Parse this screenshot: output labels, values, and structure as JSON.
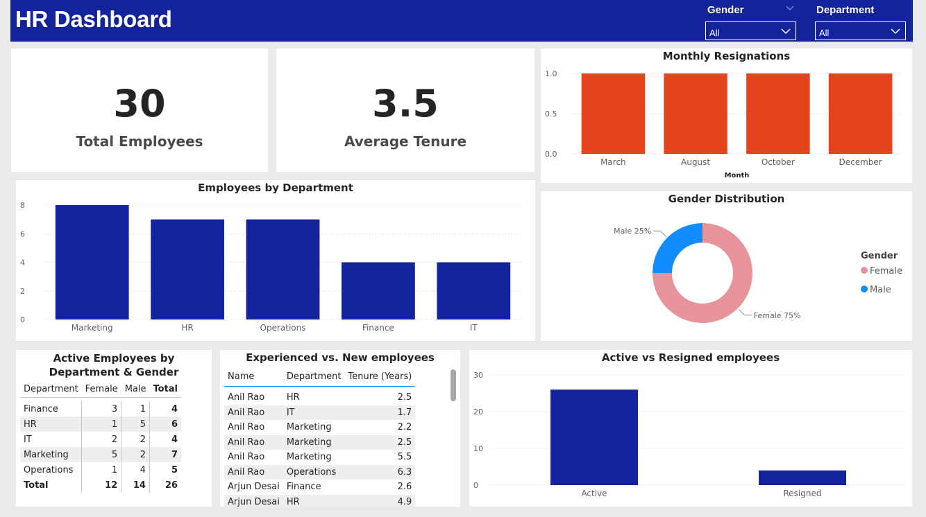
{
  "header": {
    "title": "HR Dashboard",
    "slicers": [
      {
        "label": "Gender",
        "value": "All"
      },
      {
        "label": "Department",
        "value": "All"
      }
    ]
  },
  "kpis": [
    {
      "value": "30",
      "label": "Total Employees"
    },
    {
      "value": "3.5",
      "label": "Average Tenure"
    }
  ],
  "colors": {
    "primary": "#13239b",
    "resign": "#e5431e",
    "female": "#e6939a",
    "male": "#118dff"
  },
  "chart_data": [
    {
      "id": "monthly",
      "type": "bar",
      "title": "Monthly Resignations",
      "categories": [
        "March",
        "August",
        "October",
        "December"
      ],
      "values": [
        1,
        1,
        1,
        1
      ],
      "xlabel": "Month",
      "ylabel": "",
      "ylim": [
        0,
        1
      ],
      "yticks": [
        "0.0",
        "0.5",
        "1.0"
      ],
      "grid": true
    },
    {
      "id": "dept",
      "type": "bar",
      "title": "Employees by Department",
      "categories": [
        "Marketing",
        "HR",
        "Operations",
        "Finance",
        "IT"
      ],
      "values": [
        8,
        7,
        7,
        4,
        4
      ],
      "xlabel": "",
      "ylabel": "",
      "ylim": [
        0,
        8
      ],
      "yticks": [
        "0",
        "2",
        "4",
        "6",
        "8"
      ],
      "grid": true
    },
    {
      "id": "gender",
      "type": "pie",
      "title": "Gender Distribution",
      "legend_title": "Gender",
      "legend_position": "right",
      "slices": [
        {
          "label": "Female",
          "value": 75,
          "data_label": "Female 75%"
        },
        {
          "label": "Male",
          "value": 25,
          "data_label": "Male 25%"
        }
      ]
    },
    {
      "id": "active",
      "type": "bar",
      "title": "Active vs Resigned employees",
      "categories": [
        "Active",
        "Resigned"
      ],
      "values": [
        26,
        4
      ],
      "xlabel": "",
      "ylabel": "",
      "ylim": [
        0,
        30
      ],
      "yticks": [
        "0",
        "10",
        "20",
        "30"
      ],
      "grid": true
    }
  ],
  "matrix": {
    "title": "Active Employees by Department & Gender",
    "columns": [
      "Department",
      "Female",
      "Male",
      "Total"
    ],
    "rows": [
      [
        "Finance",
        "3",
        "1",
        "4"
      ],
      [
        "HR",
        "1",
        "5",
        "6"
      ],
      [
        "IT",
        "2",
        "2",
        "4"
      ],
      [
        "Marketing",
        "5",
        "2",
        "7"
      ],
      [
        "Operations",
        "1",
        "4",
        "5"
      ]
    ],
    "total": [
      "Total",
      "12",
      "14",
      "26"
    ]
  },
  "detail": {
    "title": "Experienced vs. New employees",
    "columns": [
      "Name",
      "Department",
      "Tenure (Years)"
    ],
    "rows": [
      [
        "Anil Rao",
        "HR",
        "2.5"
      ],
      [
        "Anil Rao",
        "IT",
        "1.7"
      ],
      [
        "Anil Rao",
        "Marketing",
        "2.2"
      ],
      [
        "Anil Rao",
        "Marketing",
        "2.5"
      ],
      [
        "Anil Rao",
        "Marketing",
        "5.5"
      ],
      [
        "Anil Rao",
        "Operations",
        "6.3"
      ],
      [
        "Arjun Desai",
        "Finance",
        "2.6"
      ],
      [
        "Arjun Desai",
        "HR",
        "4.9"
      ]
    ]
  }
}
